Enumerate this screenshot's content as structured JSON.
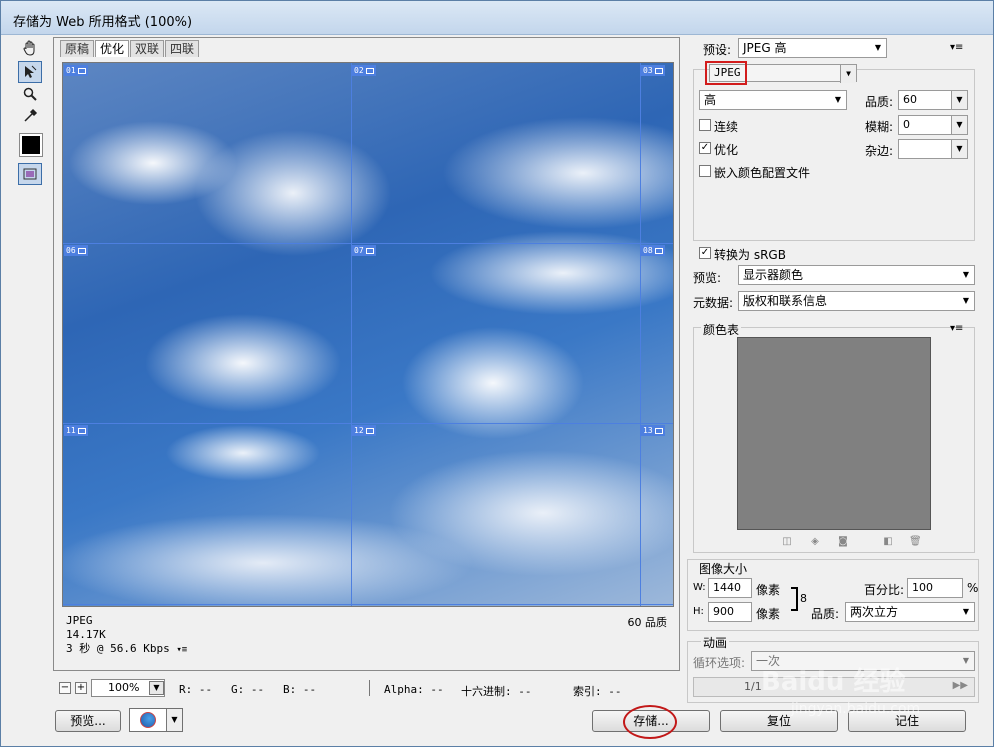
{
  "window": {
    "title": "存储为 Web 所用格式 (100%)"
  },
  "tabs": [
    "原稿",
    "优化",
    "双联",
    "四联"
  ],
  "slices": [
    "01",
    "02",
    "03",
    "06",
    "07",
    "08",
    "11",
    "12",
    "13"
  ],
  "preview_info": {
    "format": "JPEG",
    "size": "14.17K",
    "speed": "3 秒 @ 56.6 Kbps",
    "quality": "60 品质"
  },
  "statusbar": {
    "zoom": "100%",
    "r": "R: --",
    "g": "G: --",
    "b": "B: --",
    "alpha": "Alpha: --",
    "hex": "十六进制: --",
    "index": "索引: --"
  },
  "buttons": {
    "preview": "预览...",
    "save": "存储...",
    "reset": "复位",
    "remember": "记住"
  },
  "settings": {
    "preset_label": "预设:",
    "preset_value": "JPEG 高",
    "format_value": "JPEG",
    "quality_level": "高",
    "quality_label": "品质:",
    "quality_value": "60",
    "progressive_label": "连续",
    "blur_label": "模糊:",
    "blur_value": "0",
    "optimized_label": "优化",
    "matte_label": "杂边:",
    "embed_profile_label": "嵌入颜色配置文件",
    "convert_srgb_label": "转换为 sRGB",
    "preview_label": "预览:",
    "preview_value": "显示器颜色",
    "metadata_label": "元数据:",
    "metadata_value": "版权和联系信息"
  },
  "color_table": {
    "title": "颜色表"
  },
  "image_size": {
    "title": "图像大小",
    "w_label": "W:",
    "w_value": "1440",
    "h_label": "H:",
    "h_value": "900",
    "unit": "像素",
    "percent_label": "百分比:",
    "percent_value": "100",
    "percent_unit": "%",
    "quality_label": "品质:",
    "quality_value": "两次立方"
  },
  "animation": {
    "title": "动画",
    "loop_label": "循环选项:",
    "loop_value": "一次",
    "frame": "1/1"
  },
  "watermark": "Baidu 经验",
  "watermark_url": "jingyan.baidu.com",
  "colors": {
    "slice_line": "#4d7fe0",
    "highlight": "#d21c1c"
  }
}
